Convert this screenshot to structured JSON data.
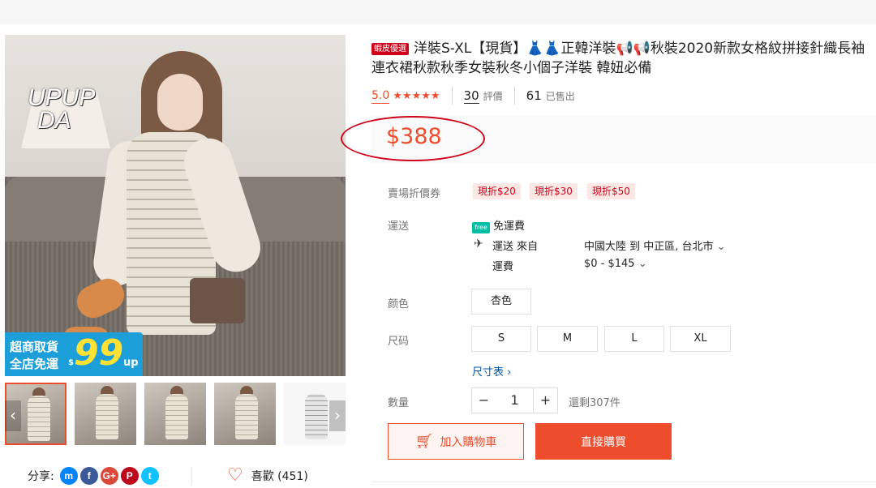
{
  "product": {
    "badge": "蝦皮優選",
    "title": "洋裝S-XL【現貨】👗👗正韓洋裝📢📢秋裝2020新款女格紋拼接針織長袖連衣裙秋款秋季女裝秋冬小個子洋裝 韓妞必備",
    "rating": "5.0",
    "stars": "★★★★★",
    "review_count": "30",
    "review_label": "評價",
    "sold_count": "61",
    "sold_label": "已售出",
    "price": "$388"
  },
  "gallery": {
    "brand_line1": "UPUP",
    "brand_line2": "DA",
    "promo_line1": "超商取貨",
    "promo_line2": "全店免運",
    "promo_dollar": "$",
    "promo_number": "99",
    "promo_up": "up",
    "prev_arrow": "‹",
    "next_arrow": "›",
    "share_label": "分享:",
    "social_icons": [
      "messenger-icon",
      "facebook-icon",
      "google-plus-icon",
      "pinterest-icon",
      "twitter-icon"
    ],
    "social_glyphs": [
      "m",
      "f",
      "G+",
      "P",
      "t"
    ],
    "social_colors": [
      "#0084ff",
      "#3b5999",
      "#db4a39",
      "#bd081c",
      "#10c2ff"
    ],
    "like_label": "喜歡 (451)"
  },
  "vouchers": {
    "label": "賣場折價券",
    "items": [
      "現折$20",
      "現折$30",
      "現折$50"
    ]
  },
  "shipping": {
    "label": "運送",
    "free_icon_text": "free",
    "free_text": "免運費",
    "from_label": "運送 來自",
    "from_value": "中國大陸 到 中正區, 台北市",
    "fee_label": "運費",
    "fee_value": "$0 - $145"
  },
  "color": {
    "label": "颜色",
    "options": [
      "杏色"
    ]
  },
  "size": {
    "label": "尺码",
    "options": [
      "S",
      "M",
      "L",
      "XL"
    ],
    "chart_link": "尺寸表 ›"
  },
  "quantity": {
    "label": "數量",
    "minus": "−",
    "value": "1",
    "plus": "+",
    "stock": "還剩307件"
  },
  "actions": {
    "add_to_cart": "加入購物車",
    "buy_now": "直接購買"
  },
  "colors": {
    "accent": "#ee4d2d",
    "badge": "#d0011b",
    "free_ship": "#00bfa5",
    "link": "#0055aa",
    "promo": "#1c9fd8"
  }
}
